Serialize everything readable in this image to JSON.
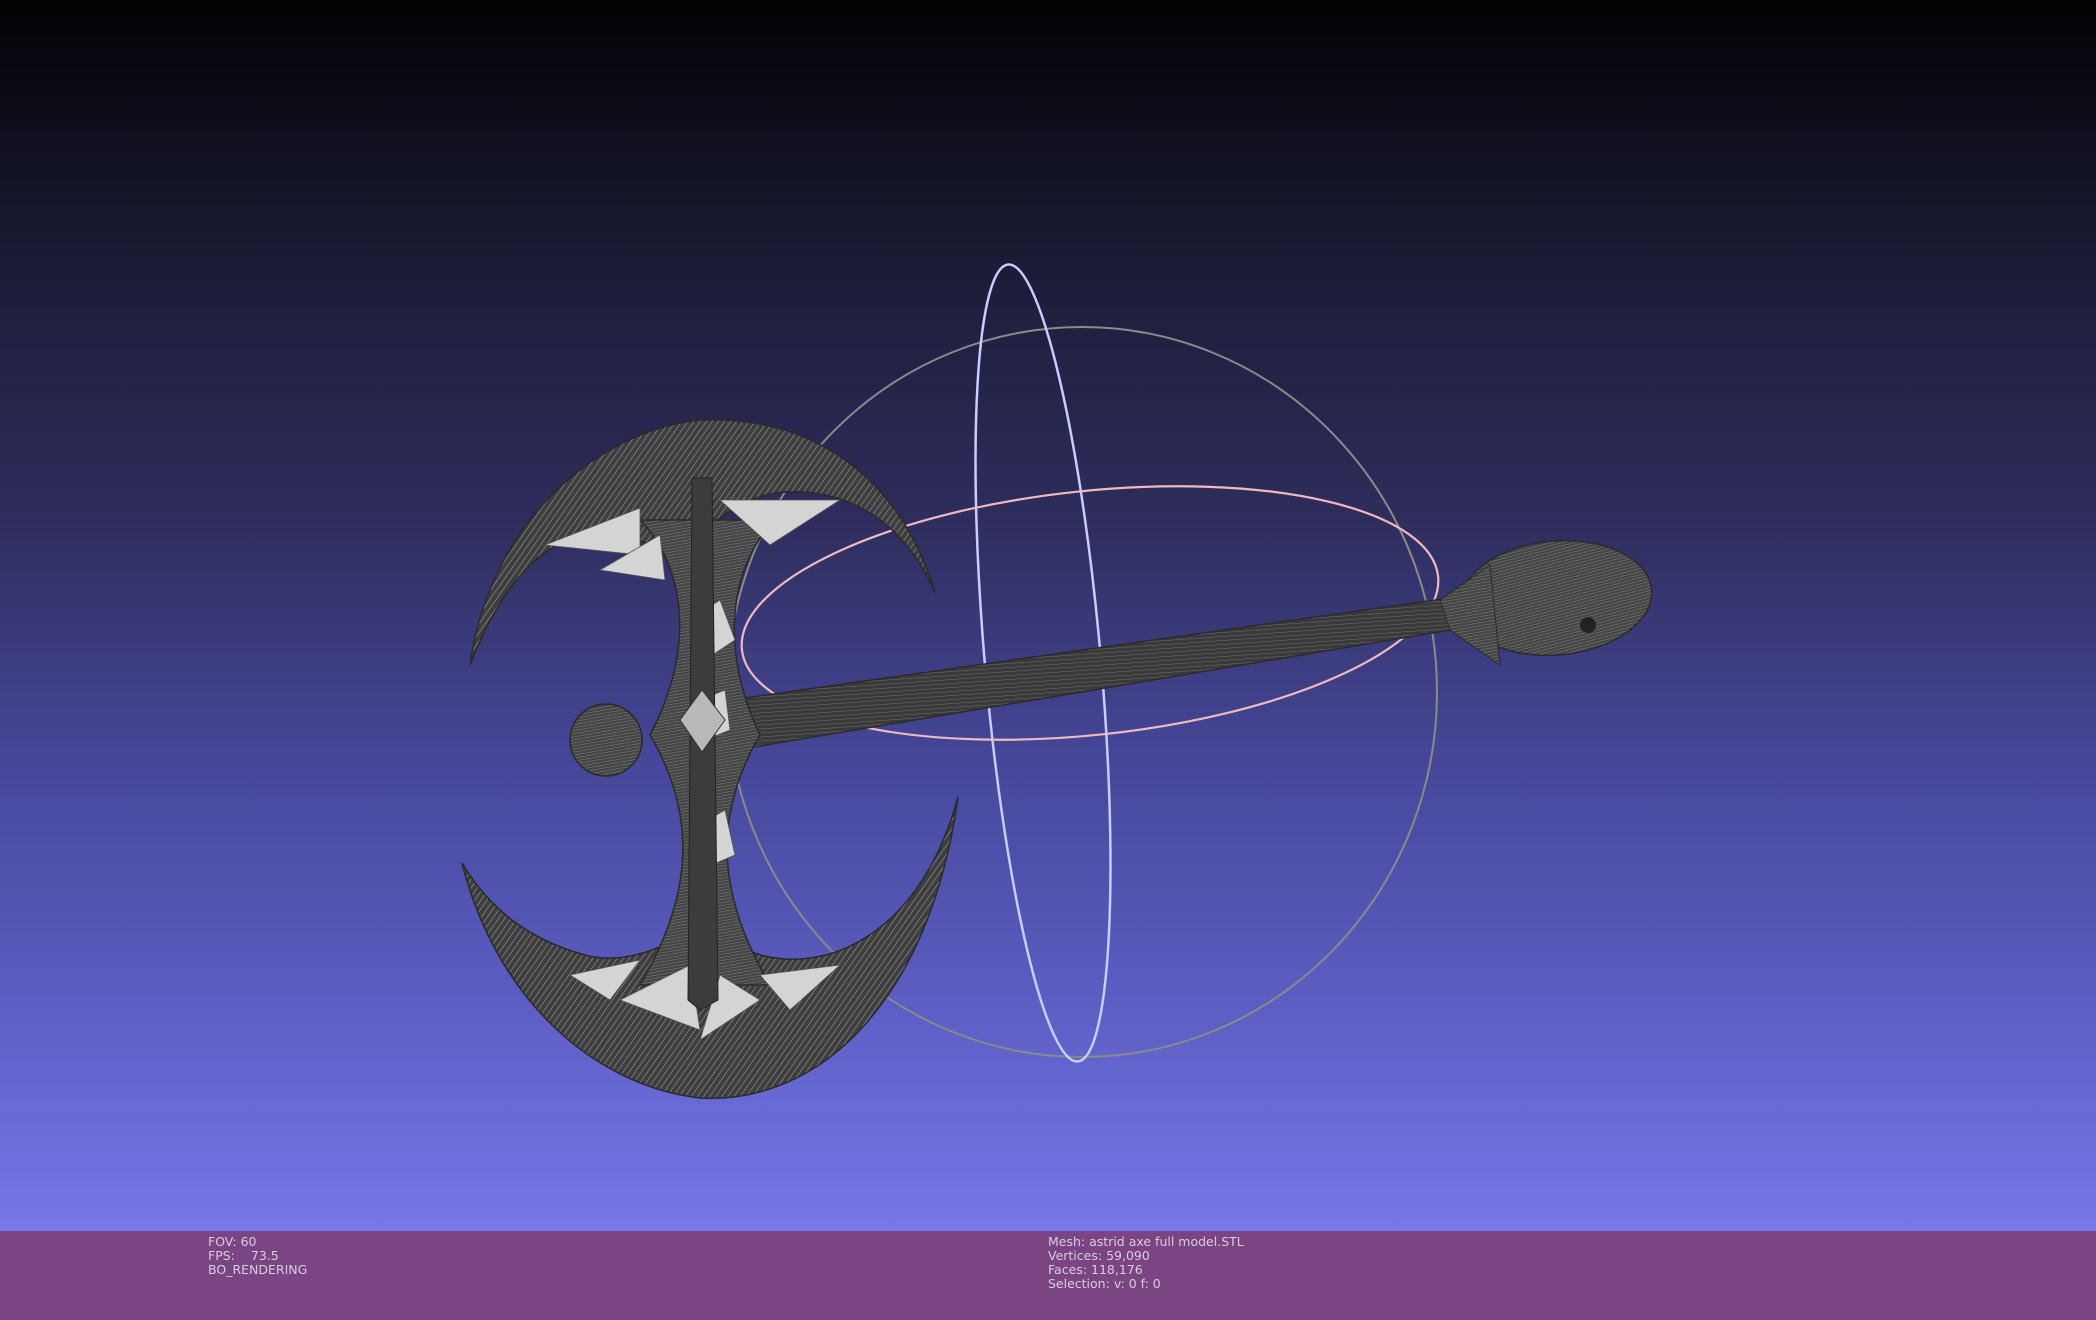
{
  "viewport": {
    "model_icon": "wireframe-battle-axe",
    "trackball_icon": "trackball-rings"
  },
  "status_left": {
    "fov_label": "FOV:",
    "fov_value": "60",
    "fps_label": "FPS:",
    "fps_value": "73.5",
    "rendering_mode": "BO_RENDERING"
  },
  "status_mesh": {
    "mesh_label": "Mesh:",
    "mesh_name": "astrid axe full model.STL",
    "vertices_label": "Vertices:",
    "vertices_value": "59,090",
    "faces_label": "Faces:",
    "faces_value": "118,176",
    "selection_label": "Selection:",
    "selection_value": "v: 0 f: 0"
  },
  "colors": {
    "statusbar_bg": "#7b4584",
    "viewport_top": "#020204",
    "viewport_bottom": "#7677ea",
    "mesh_dark": "#3e3e3e",
    "mesh_light": "#c8c8c8",
    "trackball_gray": "#8a8a8a",
    "trackball_blue": "#c8ccff",
    "trackball_pink": "#f0b8c0"
  }
}
